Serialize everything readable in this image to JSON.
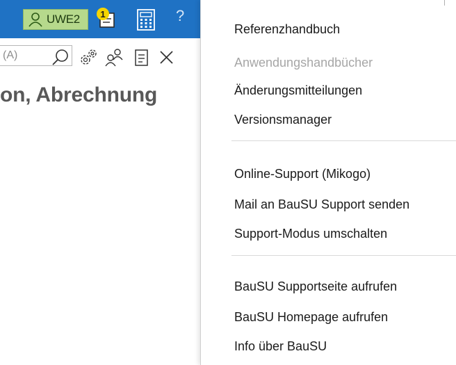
{
  "header": {
    "user_label": "UWE2",
    "notification_count": "1",
    "help_label": "?"
  },
  "toolbar": {
    "search_value": "(A)"
  },
  "page": {
    "title": "on, Abrechnung"
  },
  "menu": {
    "items": [
      {
        "label": "Referenzhandbuch",
        "enabled": true
      },
      {
        "label": "Anwendungshandbücher",
        "enabled": false
      },
      {
        "label": "Änderungsmitteilungen",
        "enabled": true
      },
      {
        "label": "Versionsmanager",
        "enabled": true
      },
      {
        "label": "Online-Support (Mikogo)",
        "enabled": true
      },
      {
        "label": "Mail an BauSU Support senden",
        "enabled": true
      },
      {
        "label": "Support-Modus umschalten",
        "enabled": true
      },
      {
        "label": "BauSU Supportseite aufrufen",
        "enabled": true
      },
      {
        "label": "BauSU Homepage aufrufen",
        "enabled": true
      },
      {
        "label": "Info über BauSU",
        "enabled": true
      }
    ]
  },
  "colors": {
    "titlebar": "#1f72c4",
    "user_badge": "#b6d98c",
    "notification_badge": "#f5d400",
    "disabled_text": "#a6a6a6"
  }
}
